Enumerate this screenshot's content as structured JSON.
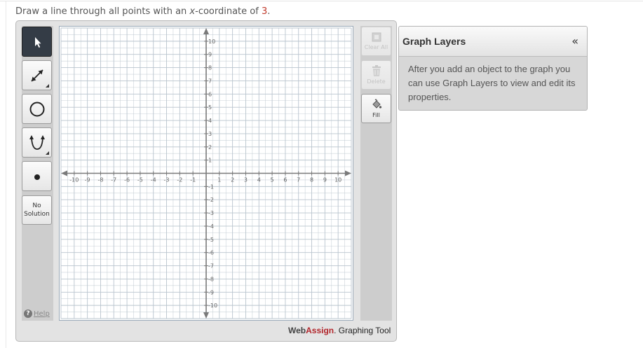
{
  "question": {
    "prefix": "Draw a line through all points with an ",
    "variable": "x",
    "middle": "-coordinate of ",
    "value": "3",
    "suffix": "."
  },
  "tools": {
    "select": {
      "icon": "pointer-arrow-icon",
      "active": true
    },
    "line": {
      "icon": "line-double-arrow-icon"
    },
    "circle": {
      "icon": "circle-icon"
    },
    "parabola": {
      "icon": "parabola-icon"
    },
    "point": {
      "icon": "point-icon"
    },
    "no_solution_line1": "No",
    "no_solution_line2": "Solution",
    "help_label": "Help",
    "help_glyph": "?"
  },
  "actions": {
    "clear_all": {
      "label": "Clear All",
      "icon": "clear-all-icon",
      "enabled": false
    },
    "delete": {
      "label": "Delete",
      "icon": "trash-icon",
      "enabled": false
    },
    "fill": {
      "label": "Fill",
      "icon": "paint-bucket-icon",
      "enabled": true
    }
  },
  "graph": {
    "x_range": [
      -11,
      11
    ],
    "y_range": [
      -11,
      11
    ],
    "x_ticks": [
      "-10",
      "-9",
      "-8",
      "-7",
      "-6",
      "-5",
      "-4",
      "-3",
      "-2",
      "-1",
      "1",
      "2",
      "3",
      "4",
      "5",
      "6",
      "7",
      "8",
      "9",
      "10"
    ],
    "y_ticks": [
      "10",
      "9",
      "8",
      "7",
      "6",
      "5",
      "4",
      "3",
      "2",
      "1",
      "-1",
      "-2",
      "-3",
      "-4",
      "-5",
      "-6",
      "-7",
      "-8",
      "-9",
      "-10"
    ],
    "grid": true,
    "colors": {
      "grid": "#b9c4ce",
      "axis": "#7a7a7a",
      "label": "#666666"
    }
  },
  "brand": {
    "part1": "Web",
    "part2": "Assign",
    "part3": ". Graphing Tool"
  },
  "layers": {
    "title": "Graph Layers",
    "collapse_glyph": "«",
    "body": "After you add an object to the graph you can use Graph Layers to view and edit its properties."
  }
}
